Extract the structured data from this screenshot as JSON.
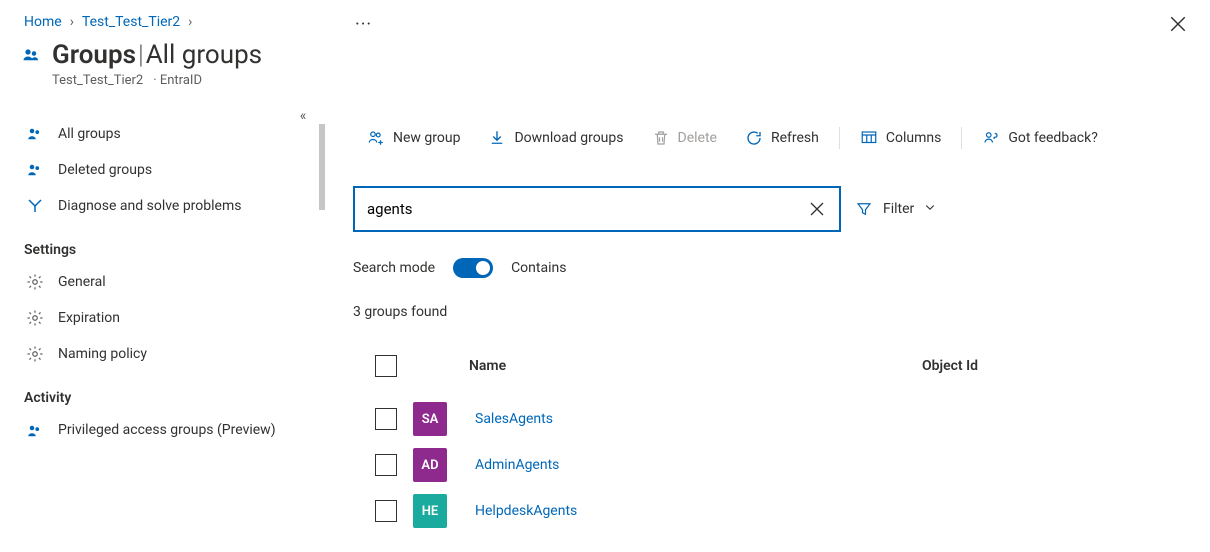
{
  "breadcrumbs": [
    {
      "label": "Home"
    },
    {
      "label": "Test_Test_Tier2"
    }
  ],
  "header": {
    "title_strong": "Groups",
    "title_rest": "All groups",
    "subtitle": "Test_Test_Tier2",
    "tag": "EntraID"
  },
  "sidebar": {
    "items_top": [
      {
        "label": "All groups"
      },
      {
        "label": "Deleted groups"
      },
      {
        "label": "Diagnose and solve problems"
      }
    ],
    "section1": "Settings",
    "items_settings": [
      {
        "label": "General"
      },
      {
        "label": "Expiration"
      },
      {
        "label": "Naming policy"
      }
    ],
    "section2": "Activity",
    "items_activity": [
      {
        "label": "Privileged access groups (Preview)"
      }
    ]
  },
  "toolbar": {
    "new_group": "New group",
    "download": "Download groups",
    "delete": "Delete",
    "refresh": "Refresh",
    "columns": "Columns",
    "feedback": "Got feedback?"
  },
  "search": {
    "value": "agents"
  },
  "filter": {
    "label": "Filter"
  },
  "mode": {
    "label": "Search mode",
    "value_label": "Contains"
  },
  "results": {
    "count_text": "3 groups found",
    "columns": {
      "name": "Name",
      "object_id": "Object Id"
    },
    "rows": [
      {
        "avatar_text": "SA",
        "avatar_bg": "#8e2a8e",
        "name": "SalesAgents"
      },
      {
        "avatar_text": "AD",
        "avatar_bg": "#8e2a8e",
        "name": "AdminAgents"
      },
      {
        "avatar_text": "HE",
        "avatar_bg": "#1aab9e",
        "name": "HelpdeskAgents"
      }
    ]
  },
  "colors": {
    "link": "#0067b8"
  }
}
